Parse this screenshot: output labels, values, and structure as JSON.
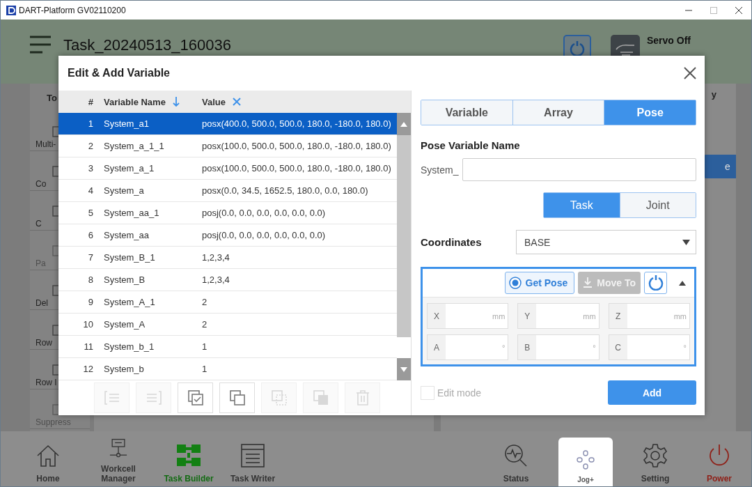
{
  "window": {
    "title": "DART-Platform GV02110200"
  },
  "header": {
    "title": "Task_20240513_160036",
    "servo_status": "Servo Off"
  },
  "sidebar": {
    "heading": "To",
    "items": [
      {
        "label": "Multi-",
        "disabled": false
      },
      {
        "label": "Co",
        "disabled": false
      },
      {
        "label": "C",
        "disabled": false
      },
      {
        "label": "Pa",
        "disabled": true
      },
      {
        "label": "Del",
        "disabled": false
      },
      {
        "label": "Row",
        "disabled": false
      },
      {
        "label": "Row I",
        "disabled": false
      },
      {
        "label": "Suppress",
        "disabled": true
      }
    ]
  },
  "right_panel": {
    "heading": "y",
    "button": "e"
  },
  "dialog": {
    "title": "Edit & Add Variable",
    "table": {
      "columns": [
        "#",
        "Variable Name",
        "Value"
      ],
      "rows": [
        {
          "index": "1",
          "name": "System_a1",
          "value": "posx(400.0, 500.0, 500.0, 180.0, -180.0, 180.0)",
          "selected": true
        },
        {
          "index": "2",
          "name": "System_a_1_1",
          "value": "posx(100.0, 500.0, 500.0, 180.0, -180.0, 180.0)",
          "selected": false
        },
        {
          "index": "3",
          "name": "System_a_1",
          "value": "posx(100.0, 500.0, 500.0, 180.0, -180.0, 180.0)",
          "selected": false
        },
        {
          "index": "4",
          "name": "System_a",
          "value": "posx(0.0, 34.5, 1652.5, 180.0, 0.0, 180.0)",
          "selected": false
        },
        {
          "index": "5",
          "name": "System_aa_1",
          "value": "posj(0.0, 0.0, 0.0, 0.0, 0.0, 0.0)",
          "selected": false
        },
        {
          "index": "6",
          "name": "System_aa",
          "value": "posj(0.0, 0.0, 0.0, 0.0, 0.0, 0.0)",
          "selected": false
        },
        {
          "index": "7",
          "name": "System_B_1",
          "value": "1,2,3,4",
          "selected": false
        },
        {
          "index": "8",
          "name": "System_B",
          "value": "1,2,3,4",
          "selected": false
        },
        {
          "index": "9",
          "name": "System_A_1",
          "value": "2",
          "selected": false
        },
        {
          "index": "10",
          "name": "System_A",
          "value": "2",
          "selected": false
        },
        {
          "index": "11",
          "name": "System_b_1",
          "value": "1",
          "selected": false
        },
        {
          "index": "12",
          "name": "System_b",
          "value": "1",
          "selected": false
        }
      ]
    },
    "toolbar": [
      {
        "kind": "outdent",
        "disabled": true
      },
      {
        "kind": "indent",
        "disabled": true
      },
      {
        "kind": "checklist",
        "disabled": false
      },
      {
        "kind": "copy",
        "disabled": false
      },
      {
        "kind": "dotted",
        "disabled": true
      },
      {
        "kind": "paste",
        "disabled": true
      },
      {
        "kind": "delete",
        "disabled": true
      }
    ],
    "type_tabs": [
      {
        "label": "Variable",
        "selected": false
      },
      {
        "label": "Array",
        "selected": false
      },
      {
        "label": "Pose",
        "selected": true
      }
    ],
    "name_label": "Pose Variable Name",
    "name_prefix": "System_",
    "space_tabs": [
      {
        "label": "Task",
        "selected": true
      },
      {
        "label": "Joint",
        "selected": false
      }
    ],
    "coordinates": {
      "label": "Coordinates",
      "value": "BASE"
    },
    "pose": {
      "get_pose": {
        "label": "Get Pose",
        "disabled": false
      },
      "move_to": {
        "label": "Move To",
        "disabled": true
      },
      "expanded": true,
      "fields": [
        {
          "label": "X",
          "unit": "mm"
        },
        {
          "label": "Y",
          "unit": "mm"
        },
        {
          "label": "Z",
          "unit": "mm"
        },
        {
          "label": "A",
          "unit": "°"
        },
        {
          "label": "B",
          "unit": "°"
        },
        {
          "label": "C",
          "unit": "°"
        }
      ]
    },
    "edit_mode": {
      "label": "Edit mode",
      "checked": false,
      "disabled": true
    },
    "add_button": "Add"
  },
  "nav": {
    "items": [
      {
        "kind": "home",
        "label": "Home",
        "selected": false
      },
      {
        "kind": "workcell",
        "label": "Workcell Manager",
        "selected": false
      },
      {
        "kind": "builder",
        "label": "Task Builder",
        "selected": true
      },
      {
        "kind": "writer",
        "label": "Task Writer",
        "selected": false
      },
      {
        "kind": "status",
        "label": "Status",
        "selected": false
      },
      {
        "kind": "jog",
        "label": "Jog+",
        "selected": false
      },
      {
        "kind": "setting",
        "label": "Setting",
        "selected": false
      },
      {
        "kind": "power",
        "label": "Power",
        "selected": false
      }
    ]
  }
}
